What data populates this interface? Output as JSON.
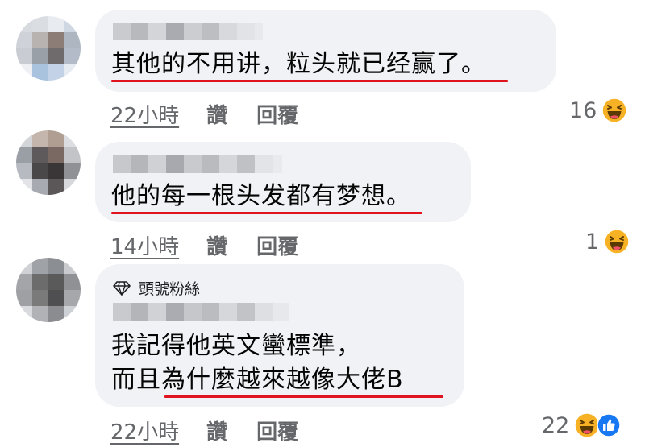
{
  "comments": [
    {
      "text_lines": [
        "其他的不用讲，粒头就已经赢了。"
      ],
      "time": "22小時",
      "like_label": "讚",
      "reply_label": "回覆",
      "reaction_count": "16",
      "reaction_icons": [
        "haha-icon"
      ]
    },
    {
      "text_lines": [
        "他的每一根头发都有梦想。"
      ],
      "time": "14小時",
      "like_label": "讚",
      "reply_label": "回覆",
      "reaction_count": "1",
      "reaction_icons": [
        "haha-icon"
      ]
    },
    {
      "badge": "頭號粉絲",
      "text_lines": [
        "我記得他英文蠻標準，",
        "而且為什麼越來越像大佬B"
      ],
      "time": "22小時",
      "like_label": "讚",
      "reply_label": "回覆",
      "reaction_count": "22",
      "reaction_icons": [
        "haha-icon",
        "like-icon"
      ]
    }
  ],
  "colors": {
    "bubble": "#f0f2f5",
    "underline": "#e0141e",
    "meta_text": "#65676b",
    "haha": "#f7b125",
    "like": "#1877f2"
  }
}
